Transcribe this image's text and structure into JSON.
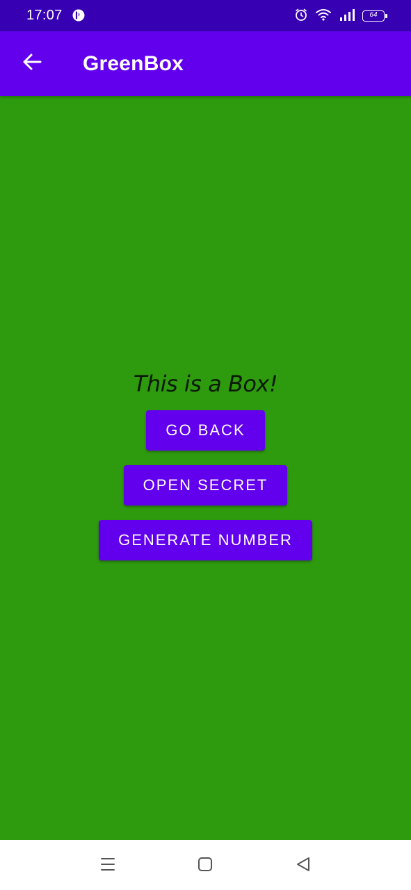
{
  "status_bar": {
    "time": "17:07",
    "battery_level": "64",
    "icons": [
      "app-notification-icon",
      "alarm-icon",
      "wifi-icon",
      "signal-icon",
      "battery-icon"
    ]
  },
  "app_bar": {
    "title": "GreenBox",
    "back_icon": "arrow-back-icon",
    "background": "#6200ee"
  },
  "main": {
    "background": "#2e9a0e",
    "label": "This is a Box!",
    "buttons": [
      {
        "label": "GO BACK"
      },
      {
        "label": "OPEN SECRET"
      },
      {
        "label": "GENERATE NUMBER"
      }
    ],
    "button_color": "#6200ee"
  },
  "nav_bar": {
    "icons": [
      "menu-icon",
      "home-square-icon",
      "back-triangle-icon"
    ]
  }
}
